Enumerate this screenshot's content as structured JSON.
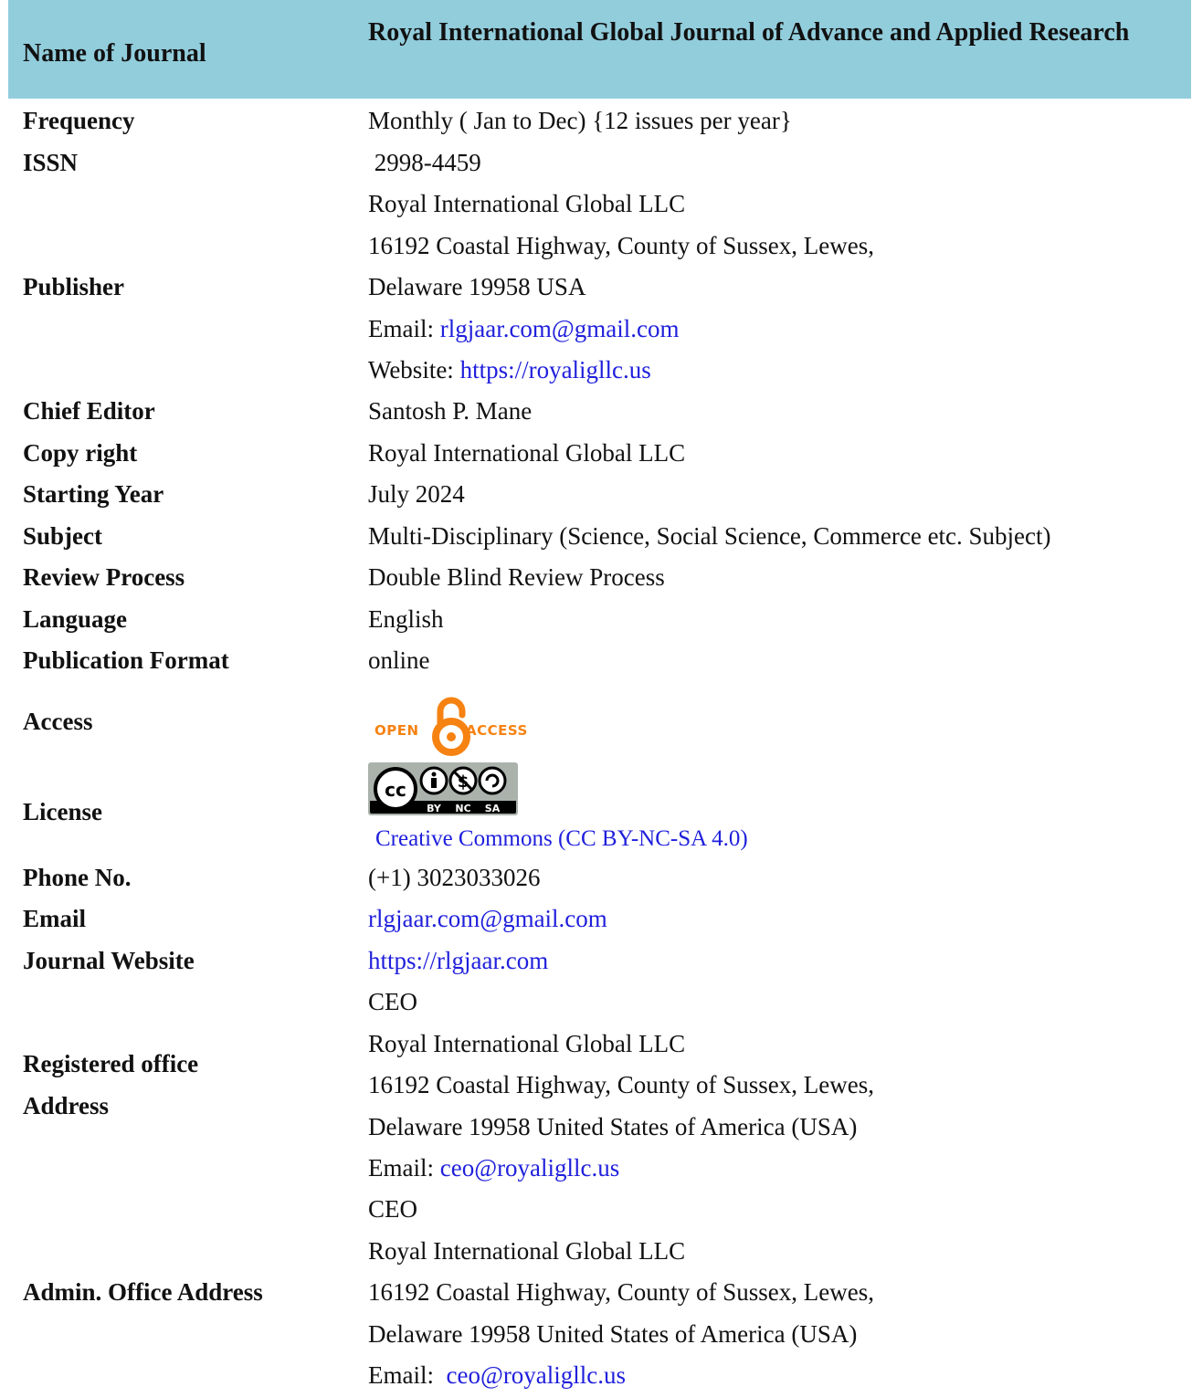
{
  "header": {
    "label": "Name of Journal",
    "value": "Royal International Global Journal of Advance and Applied Research"
  },
  "rows": {
    "frequency": {
      "label": "Frequency",
      "value": "Monthly ( Jan to Dec) {12 issues per year}"
    },
    "issn": {
      "label": "ISSN",
      "value": " 2998-4459"
    },
    "publisher": {
      "label": "Publisher",
      "lines": [
        "Royal International Global LLC",
        "16192 Coastal Highway, County of Sussex, Lewes,",
        "Delaware 19958 USA"
      ],
      "email_prefix": "Email: ",
      "email": "rlgjaar.com@gmail.com",
      "website_prefix": "Website: ",
      "website": "https://royaligllc.us"
    },
    "chief_editor": {
      "label": "Chief Editor",
      "value": "Santosh P. Mane"
    },
    "copyright": {
      "label": "Copy right",
      "value": "Royal International Global LLC"
    },
    "starting_year": {
      "label": "Starting Year",
      "value": "July 2024"
    },
    "subject": {
      "label": "Subject",
      "value": "Multi-Disciplinary (Science, Social Science, Commerce etc. Subject)"
    },
    "review": {
      "label": "Review Process",
      "value": "Double Blind Review Process"
    },
    "language": {
      "label": "Language",
      "value": "English"
    },
    "format": {
      "label": "Publication Format",
      "value": "online"
    },
    "access": {
      "label": "Access",
      "logo_open": "OPEN",
      "logo_access": "ACCESS",
      "icon": "open-access-lock"
    },
    "license": {
      "label": "License",
      "badge_terms": [
        "BY",
        "NC",
        "SA"
      ],
      "badge_mark": "cc",
      "link": "Creative Commons (CC BY-NC-SA 4.0)"
    },
    "phone": {
      "label": "Phone No.",
      "value": "(+1) 3023033026"
    },
    "email": {
      "label": "Email",
      "value": "rlgjaar.com@gmail.com"
    },
    "website": {
      "label": "Journal Website",
      "value": "https://rlgjaar.com"
    },
    "registered": {
      "label_1": "Registered office",
      "label_2": "Address",
      "lines": [
        "CEO",
        "Royal International Global LLC",
        "16192 Coastal Highway, County of Sussex, Lewes,",
        "Delaware 19958 United States of America (USA)"
      ],
      "email_prefix": "Email: ",
      "email": "ceo@royaligllc.us"
    },
    "admin": {
      "label": "Admin. Office Address",
      "lines": [
        "CEO",
        "Royal International Global LLC",
        "16192 Coastal Highway, County of Sussex, Lewes,",
        "Delaware 19958 United States of America (USA)"
      ],
      "email_prefix": "Email:  ",
      "email": "ceo@royaligllc.us"
    }
  },
  "colors": {
    "header_bg": "#92cddc",
    "link": "#1f1fdc",
    "oa_orange": "#f68212"
  }
}
